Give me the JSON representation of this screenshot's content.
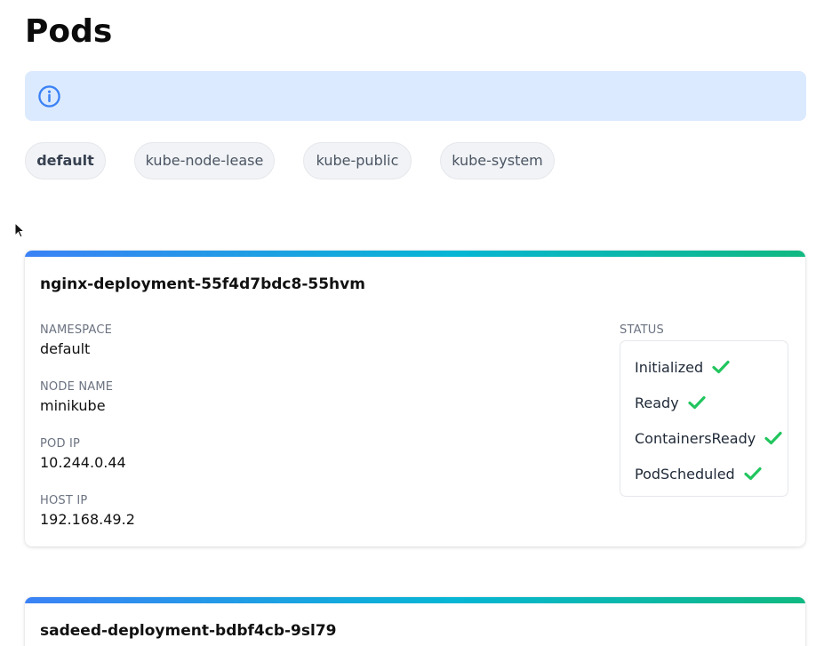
{
  "page": {
    "title": "Pods"
  },
  "info_bar": {
    "icon": "info-icon",
    "accent_color": "#3b82f6",
    "background": "#dbeafe"
  },
  "namespaces": [
    {
      "label": "default",
      "active": true
    },
    {
      "label": "kube-node-lease",
      "active": false
    },
    {
      "label": "kube-public",
      "active": false
    },
    {
      "label": "kube-system",
      "active": false
    }
  ],
  "pods": [
    {
      "name": "nginx-deployment-55f4d7bdc8-55hvm",
      "fields": [
        {
          "label": "NAMESPACE",
          "value": "default"
        },
        {
          "label": "NODE NAME",
          "value": "minikube"
        },
        {
          "label": "POD IP",
          "value": "10.244.0.44"
        },
        {
          "label": "HOST IP",
          "value": "192.168.49.2"
        }
      ],
      "status_label": "STATUS",
      "conditions": [
        {
          "label": "Initialized",
          "icon": "check-icon"
        },
        {
          "label": "Ready",
          "icon": "check-icon"
        },
        {
          "label": "ContainersReady",
          "icon": "check-icon"
        },
        {
          "label": "PodScheduled",
          "icon": "check-icon"
        }
      ]
    },
    {
      "name": "sadeed-deployment-bdbf4cb-9sl79"
    }
  ],
  "colors": {
    "check": "#22c55e",
    "accent_start": "#3b82f6",
    "accent_end": "#10b981"
  }
}
